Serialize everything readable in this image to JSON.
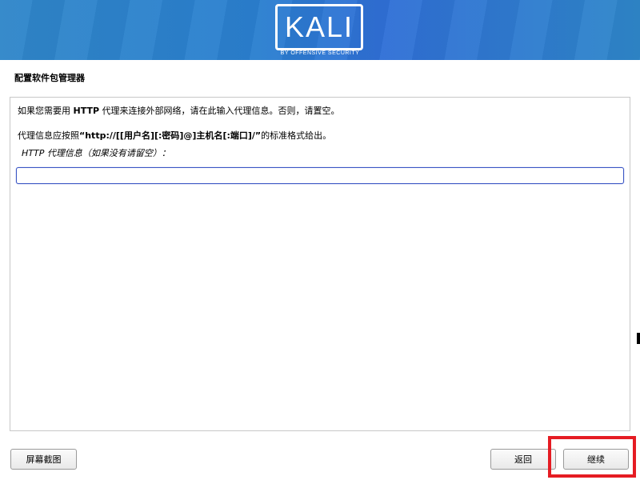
{
  "header": {
    "logo_text": "KALI",
    "logo_subtitle": "BY OFFENSIVE SECURITY"
  },
  "page": {
    "title": "配置软件包管理器"
  },
  "content": {
    "line1_prefix": "如果您需要用 ",
    "line1_bold": "HTTP",
    "line1_suffix": " 代理来连接外部网络，请在此输入代理信息。否则，请置空。",
    "line2_prefix": "代理信息应按照",
    "line2_bold": "“http://[[用户名][:密码]@]主机名[:端口]/”",
    "line2_suffix": "的标准格式给出。",
    "field_label": "HTTP 代理信息（如果没有请留空）：",
    "field_value": ""
  },
  "buttons": {
    "screenshot": "屏幕截图",
    "back": "返回",
    "continue": "继续"
  },
  "colors": {
    "banner": "#2f7fcf",
    "input_border": "#3b56c4",
    "highlight": "#e51c23"
  }
}
